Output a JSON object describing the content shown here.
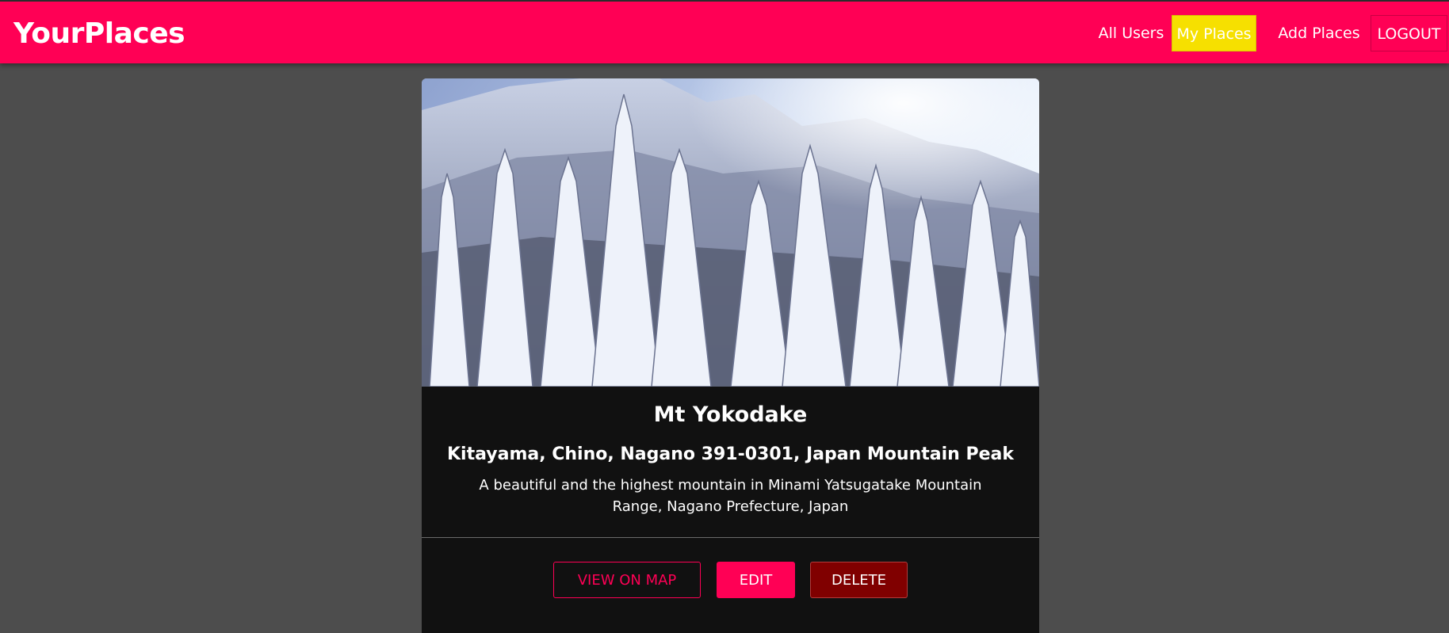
{
  "header": {
    "brand": "YourPlaces",
    "nav": {
      "all_users": "All Users",
      "my_places": "My Places",
      "add_places": "Add Places",
      "logout": "LOGOUT"
    },
    "colors": {
      "bar": "#ff0055",
      "active": "#f6e000"
    }
  },
  "place": {
    "title": "Mt Yokodake",
    "address": "Kitayama, Chino, Nagano 391-0301, Japan Mountain Peak",
    "description": "A beautiful and the highest mountain in Minami Yatsugatake Mountain Range, Nagano Prefecture, Japan",
    "image": "snowy-forest-mountain",
    "actions": {
      "view_on_map": "VIEW ON MAP",
      "edit": "EDIT",
      "delete": "DELETE"
    }
  }
}
